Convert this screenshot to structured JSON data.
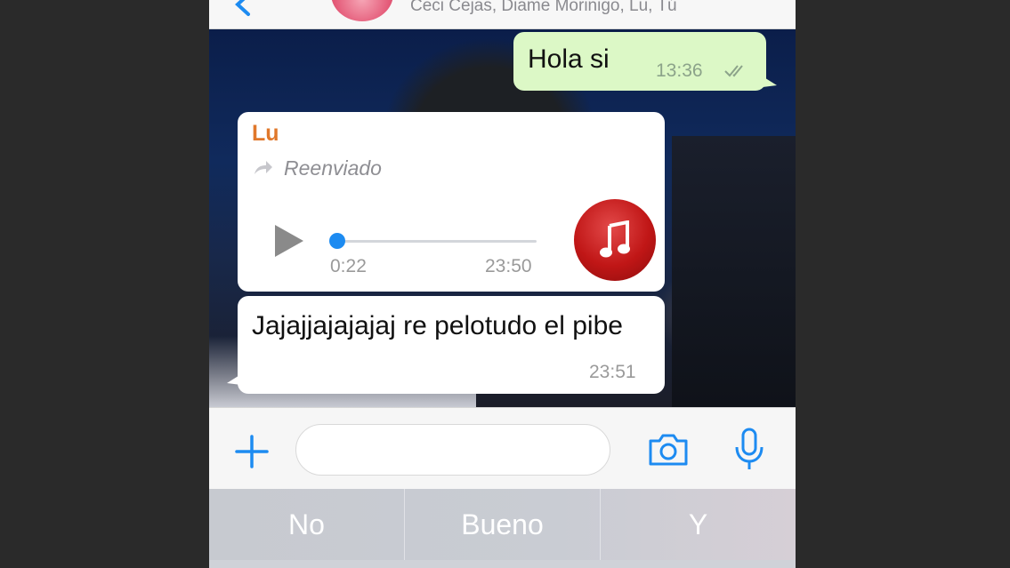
{
  "header": {
    "participants": "Ceci Cejas, Diame Morinigo, Lu, Tú"
  },
  "messages": {
    "outgoing": {
      "text": "Hola si",
      "time": "13:36"
    },
    "audio": {
      "sender": "Lu",
      "forwarded_label": "Reenviado",
      "elapsed": "0:22",
      "timestamp": "23:50",
      "progress": 0.0
    },
    "text_in": {
      "text": "Jajajjajajajaj re pelotudo el pibe",
      "time": "23:51"
    }
  },
  "input": {
    "placeholder": ""
  },
  "suggestions": [
    "No",
    "Bueno",
    "Y"
  ],
  "colors": {
    "outgoing_bubble": "#dcf8c6",
    "sender_name": "#e0782b",
    "accent_blue": "#1d8bf1"
  },
  "icons": [
    "back-icon",
    "double-check-icon",
    "forward-icon",
    "play-icon",
    "music-note-icon",
    "plus-icon",
    "camera-icon",
    "microphone-icon"
  ]
}
